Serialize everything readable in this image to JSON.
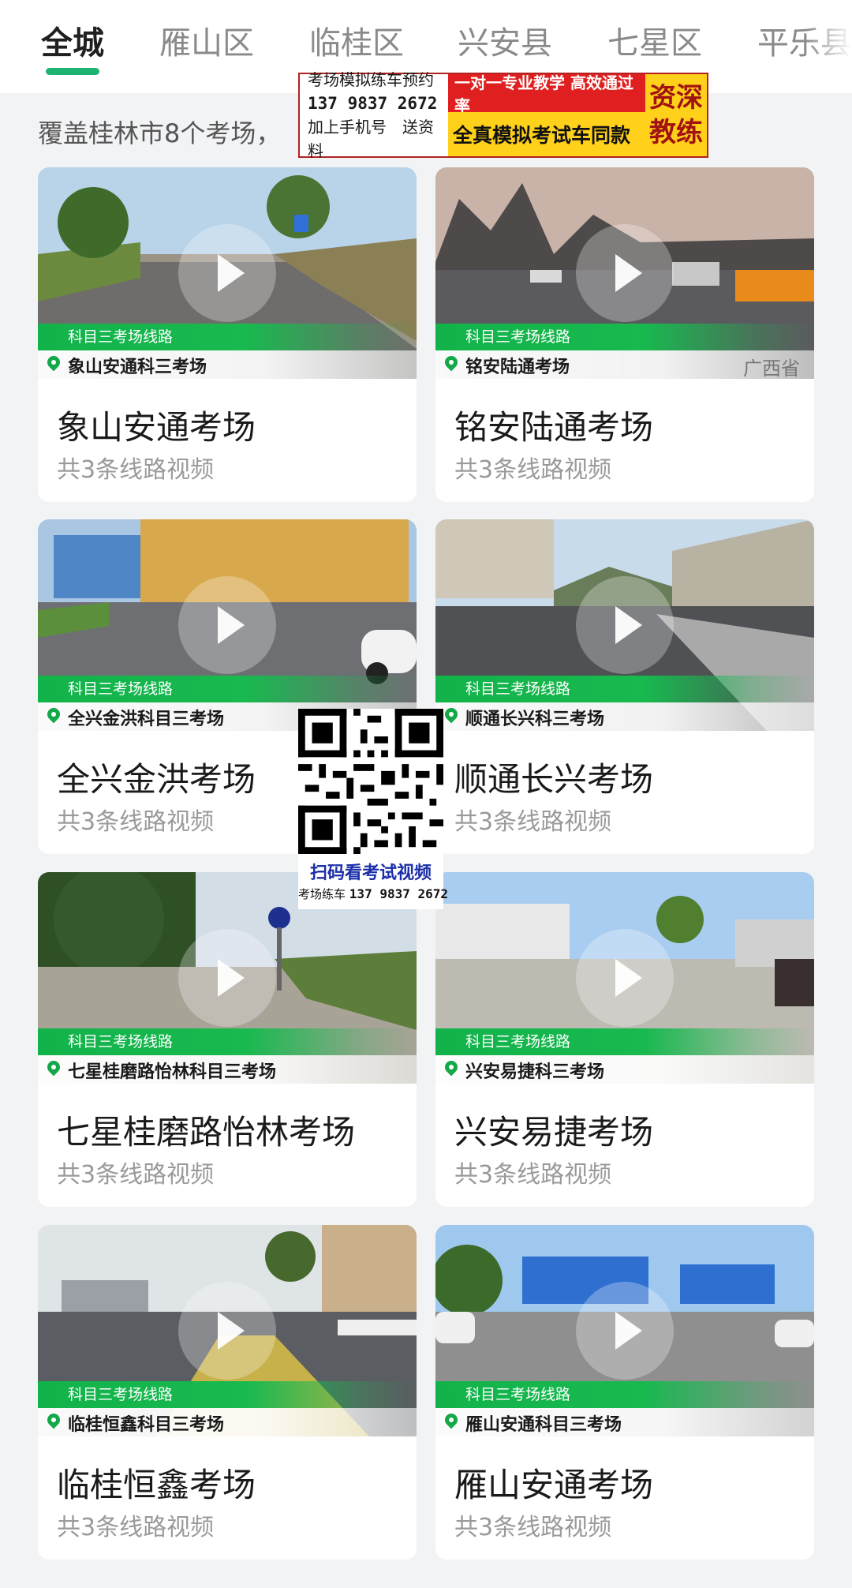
{
  "tabs": [
    {
      "label": "全城",
      "active": true
    },
    {
      "label": "雁山区",
      "active": false
    },
    {
      "label": "临桂区",
      "active": false
    },
    {
      "label": "兴安县",
      "active": false
    },
    {
      "label": "七星区",
      "active": false
    },
    {
      "label": "平乐县",
      "active": false
    }
  ],
  "summary": "覆盖桂林市8个考场，",
  "ad": {
    "line1": "考场模拟练车预约",
    "phone": "137 9837 2672",
    "line3": "加上手机号　送资料",
    "slogan1": "一对一专业教学 高效通过率",
    "slogan2": "全真模拟考试车同款",
    "badge1": "资深",
    "badge2": "教练"
  },
  "cards": [
    {
      "tag": "科目三考场线路",
      "location": "象山安通科三考场",
      "province": "",
      "title": "象山安通考场",
      "subtitle": "共3条线路视频"
    },
    {
      "tag": "科目三考场线路",
      "location": "铭安陆通考场",
      "province": "广西省",
      "title": "铭安陆通考场",
      "subtitle": "共3条线路视频"
    },
    {
      "tag": "科目三考场线路",
      "location": "全兴金洪科目三考场",
      "province": "",
      "title": "全兴金洪考场",
      "subtitle": "共3条线路视频"
    },
    {
      "tag": "科目三考场线路",
      "location": "顺通长兴科三考场",
      "province": "",
      "title": "顺通长兴考场",
      "subtitle": "共3条线路视频"
    },
    {
      "tag": "科目三考场线路",
      "location": "七星桂磨路怡林科目三考场",
      "province": "",
      "title": "七星桂磨路怡林考场",
      "subtitle": "共3条线路视频"
    },
    {
      "tag": "科目三考场线路",
      "location": "兴安易捷科三考场",
      "province": "",
      "title": "兴安易捷考场",
      "subtitle": "共3条线路视频"
    },
    {
      "tag": "科目三考场线路",
      "location": "临桂恒鑫科目三考场",
      "province": "",
      "title": "临桂恒鑫考场",
      "subtitle": "共3条线路视频"
    },
    {
      "tag": "科目三考场线路",
      "location": "雁山安通科目三考场",
      "province": "",
      "title": "雁山安通考场",
      "subtitle": "共3条线路视频"
    }
  ],
  "qr": {
    "caption": "扫码看考试视频",
    "label": "考场练车",
    "phone": "137 9837 2672"
  }
}
